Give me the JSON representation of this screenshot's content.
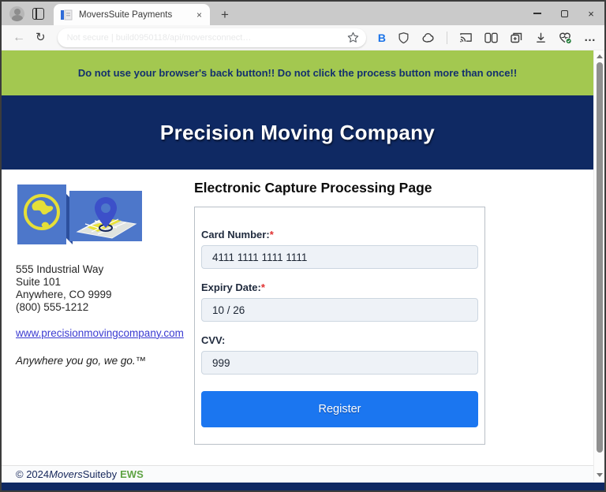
{
  "window": {
    "tab": {
      "title": "MoversSuite Payments",
      "close_glyph": "×"
    },
    "new_tab_glyph": "+",
    "controls": {
      "close_glyph": "×"
    },
    "toolbar": {
      "back_glyph": "←",
      "refresh_glyph": "↻",
      "url_text": "Not secure  |  build0950118/api/moversconnect…",
      "bitwarden_label": "B",
      "menu_glyph": "…"
    }
  },
  "banner": {
    "text": "Do not use your browser's back button!! Do not click the process button more than once!!"
  },
  "hero": {
    "title": "Precision Moving Company"
  },
  "sidebar": {
    "address_lines": [
      "555 Industrial Way",
      "Suite 101",
      "Anywhere, CO 9999",
      "(800) 555-1212"
    ],
    "website": "www.precisionmovingcompany.com",
    "tagline": "Anywhere you go, we go.™"
  },
  "main": {
    "heading": "Electronic Capture Processing Page",
    "form": {
      "fields": [
        {
          "label": "Card Number:",
          "asterisk": "*",
          "value": "4111 1111 1111 1111"
        },
        {
          "label": "Expiry Date:",
          "asterisk": "*",
          "value": "10 / 26"
        },
        {
          "label": "CVV:",
          "asterisk": "",
          "value": "999"
        }
      ],
      "submit_label": "Register"
    }
  },
  "footer": {
    "prefix": "© 2024 ",
    "brand_italic": "Movers",
    "brand_rest": "Suite",
    "connector": " by",
    "company": "EWS"
  },
  "colors": {
    "banner_green": "#a3c850",
    "navy": "#0f2963",
    "button_blue": "#1b76f0",
    "link_blue": "#3a3ad1",
    "ews_green": "#5fa344",
    "required_red": "#e03131"
  }
}
